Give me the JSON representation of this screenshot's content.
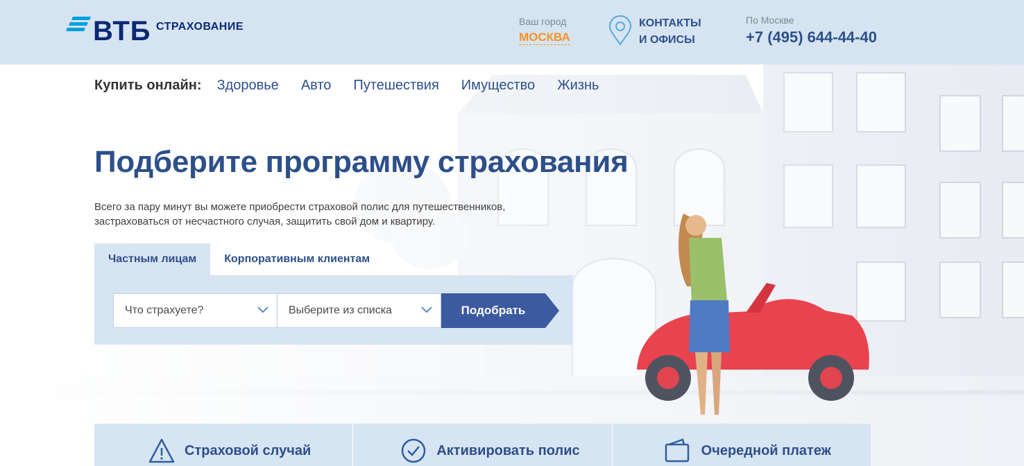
{
  "header": {
    "logo_text": "ВТБ",
    "logo_subtitle": "СТРАХОВАНИЕ",
    "city_label": "Ваш город",
    "city_value": "МОСКВА",
    "contacts_line1": "КОНТАКТЫ",
    "contacts_line2": "И ОФИСЫ",
    "phone_label": "По Москве",
    "phone_value": "+7 (495) 644-44-40"
  },
  "nav": {
    "label": "Купить онлайн:",
    "links": [
      "Здоровье",
      "Авто",
      "Путешествия",
      "Имущество",
      "Жизнь"
    ]
  },
  "hero": {
    "title": "Подберите программу страхования",
    "lead_line1": "Всего за пару минут вы можете приобрести страховой полис для путешественников,",
    "lead_line2": "застраховаться от несчастного случая, защитить свой дом и квартиру."
  },
  "tabs": [
    {
      "label": "Частным  лицам",
      "active": true
    },
    {
      "label": "Корпоративным  клиентам",
      "active": false
    }
  ],
  "form": {
    "select1": "Что страхуете?",
    "select2": "Выберите из списка",
    "submit": "Подобрать"
  },
  "actions": [
    {
      "label": "Страховой случай",
      "icon": "warning-icon"
    },
    {
      "label": "Активировать полис",
      "icon": "check-circle-icon"
    },
    {
      "label": "Очередной платеж",
      "icon": "wallet-icon"
    }
  ],
  "colors": {
    "header_bg": "#d6e4f2",
    "brand_blue": "#2d4f8a",
    "logo_navy": "#0a2973",
    "logo_cyan": "#009fdf",
    "city_orange": "#f7931e",
    "button_blue": "#3b5aa0"
  }
}
